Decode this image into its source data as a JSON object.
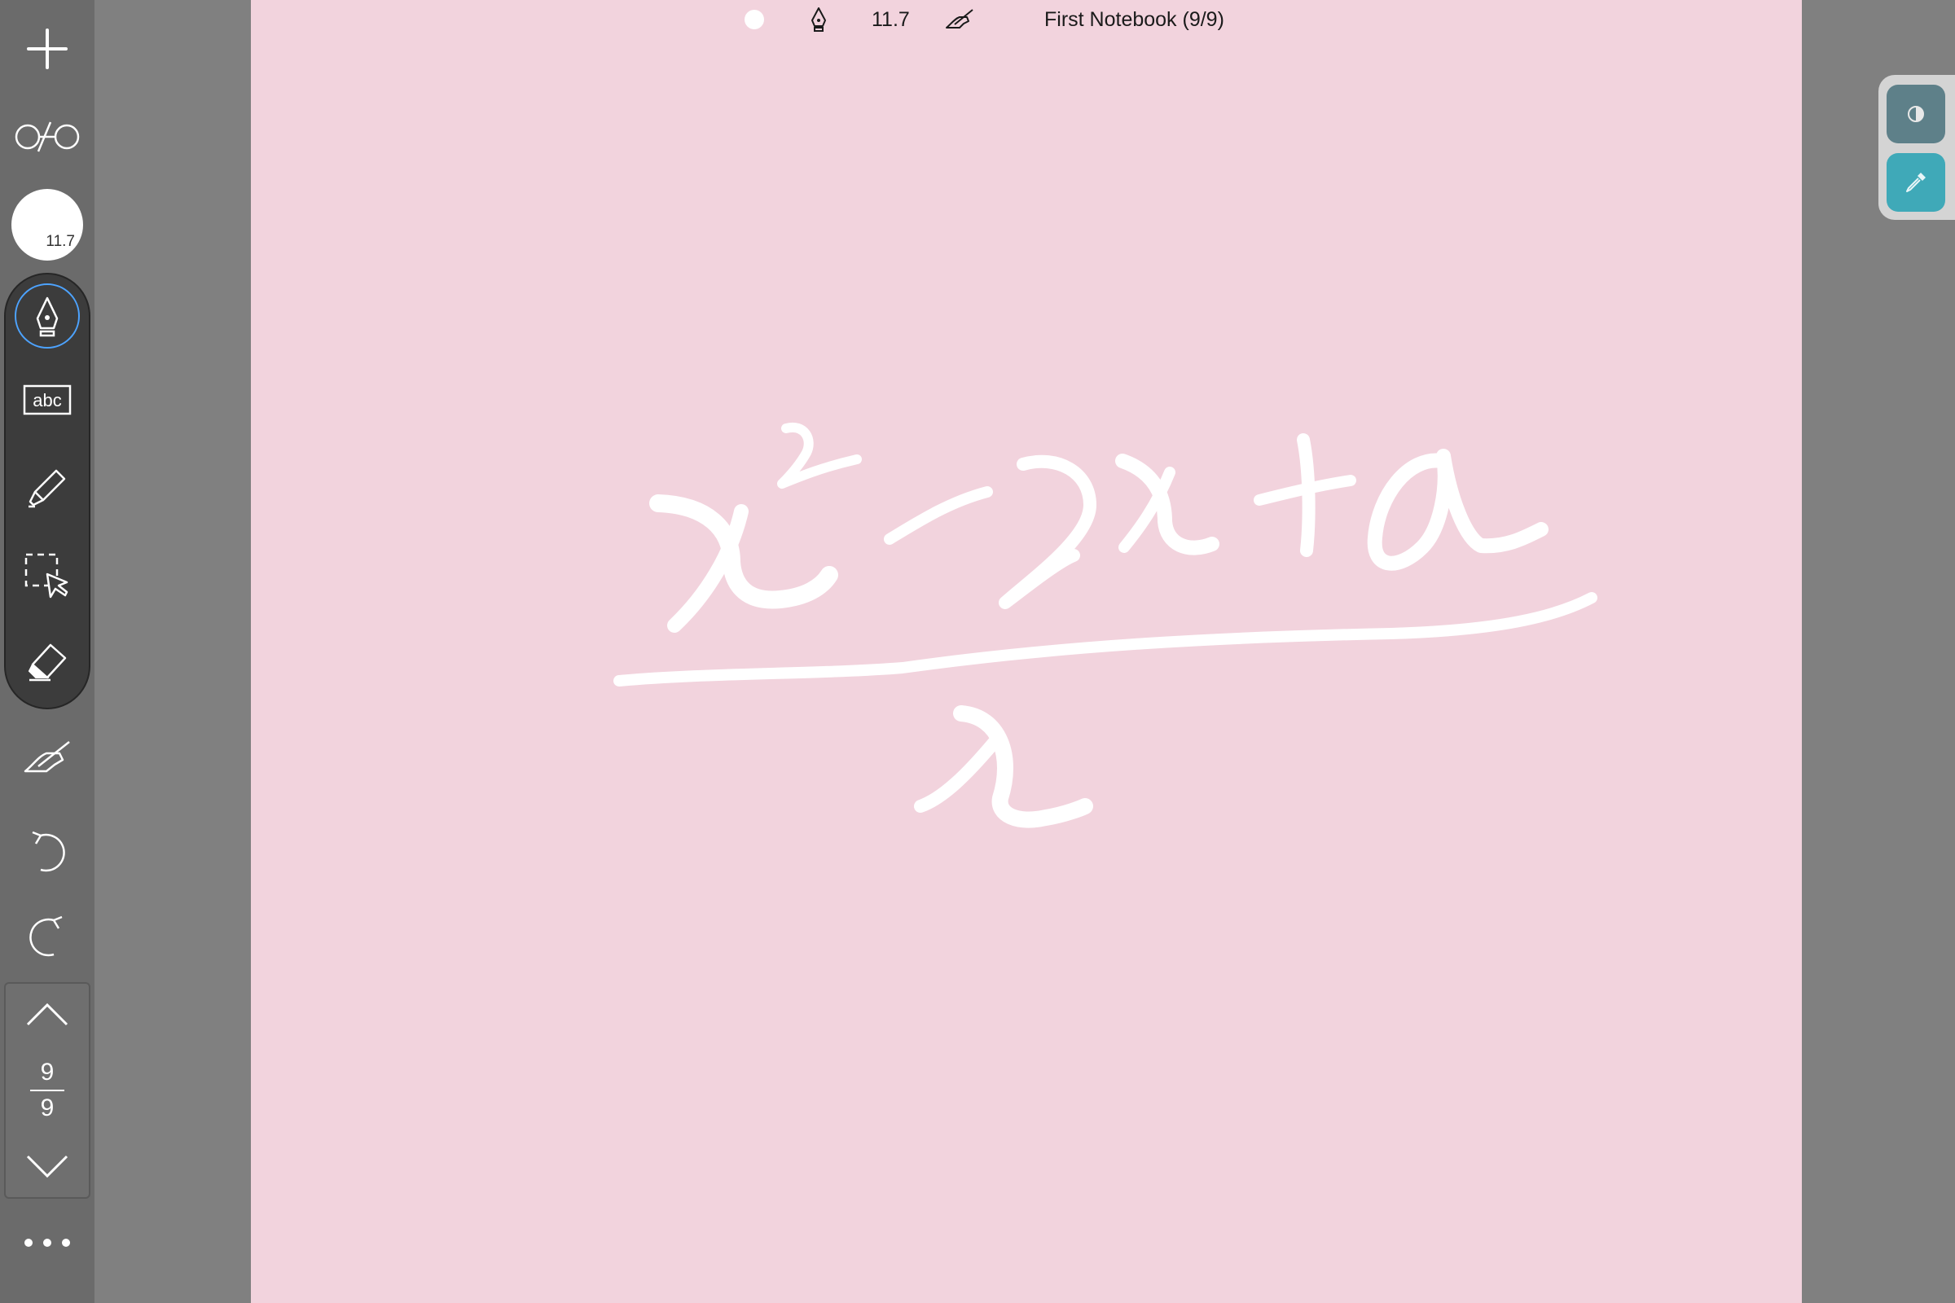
{
  "sidebar": {
    "brush_size": "11.7",
    "page_current": "9",
    "page_total": "9",
    "icons": {
      "add": "plus-icon",
      "view": "glasses-icon",
      "pen": "fountain-pen-icon",
      "text": "abc-text-icon",
      "highlighter": "highlighter-icon",
      "select": "lasso-select-icon",
      "eraser": "eraser-icon",
      "palm_rejection": "hand-pen-icon",
      "undo": "undo-icon",
      "redo": "redo-icon",
      "page_up": "chevron-up-icon",
      "page_down": "chevron-down-icon",
      "more": "more-dots-icon"
    }
  },
  "header": {
    "brush_size": "11.7",
    "notebook_title": "First Notebook (9/9)"
  },
  "canvas": {
    "background_color": "#f2d3dd",
    "ink_color": "#ffffff"
  },
  "palette": {
    "icons": [
      "contrast-icon",
      "eyedropper-icon"
    ],
    "colors": [
      "#5e8089",
      "#3fa9b8"
    ]
  },
  "colors": {
    "accent": "#4da3ff",
    "sidebar_bg": "#6b6b6b",
    "tool_group_bg": "#3c3c3c",
    "outer_bg": "#808080"
  }
}
